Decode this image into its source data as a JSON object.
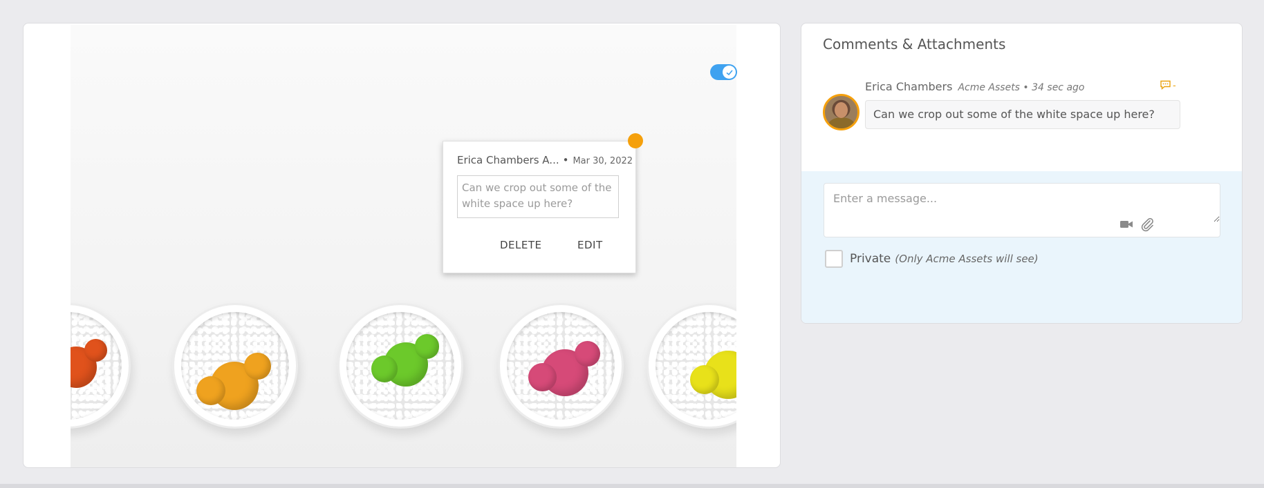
{
  "image_viewer": {
    "toggle_state": "on",
    "annotation_popup": {
      "author": "Erica Chambers A...",
      "separator": "•",
      "date": "Mar 30, 2022",
      "comment_text": "Can we crop out some of the white space up here?",
      "delete_label": "DELETE",
      "edit_label": "EDIT"
    },
    "plant_colors": [
      "#e0521c",
      "#efa21f",
      "#6cc92b",
      "#d64a78",
      "#e8e11a"
    ]
  },
  "comments_panel": {
    "title": "Comments & Attachments",
    "comments": [
      {
        "author": "Erica Chambers",
        "meta": "Acme Assets • 34 sec ago",
        "reply_count": "-",
        "text": "Can we crop out some of the white space up here?"
      }
    ],
    "compose": {
      "placeholder": "Enter a message...",
      "private_label": "Private",
      "private_note": "(Only Acme Assets will see)"
    }
  },
  "colors": {
    "accent_blue": "#3fa2f0",
    "marker_orange": "#f5a00c",
    "compose_bg": "#eaf5fc"
  },
  "icons": [
    "check-icon",
    "comment-icon",
    "video-icon",
    "paperclip-icon"
  ]
}
